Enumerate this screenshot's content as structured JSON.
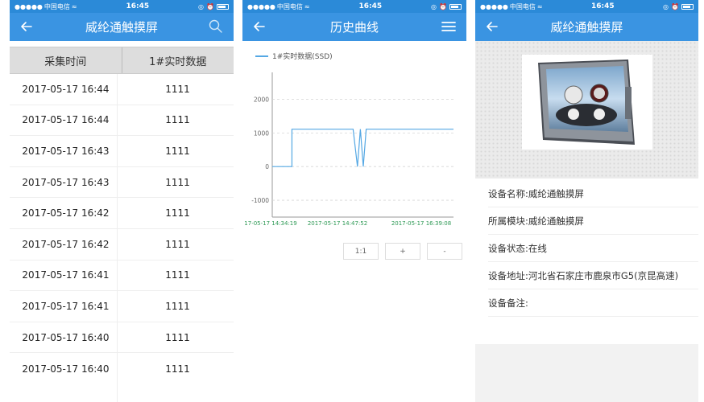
{
  "status": {
    "carrier": "中国电信",
    "time": "16:45"
  },
  "screen1": {
    "title": "威纶通触摸屏",
    "columns": [
      "采集时间",
      "1#实时数据"
    ],
    "rows": [
      [
        "2017-05-17 16:44",
        "1111"
      ],
      [
        "2017-05-17 16:44",
        "1111"
      ],
      [
        "2017-05-17 16:43",
        "1111"
      ],
      [
        "2017-05-17 16:43",
        "1111"
      ],
      [
        "2017-05-17 16:42",
        "1111"
      ],
      [
        "2017-05-17 16:42",
        "1111"
      ],
      [
        "2017-05-17 16:41",
        "1111"
      ],
      [
        "2017-05-17 16:41",
        "1111"
      ],
      [
        "2017-05-17 16:40",
        "1111"
      ],
      [
        "2017-05-17 16:40",
        "1111"
      ]
    ]
  },
  "screen2": {
    "title": "历史曲线",
    "zoom": {
      "reset": "1:1",
      "plus": "+",
      "minus": "-"
    }
  },
  "chart_data": {
    "type": "line",
    "series": [
      {
        "name": "1#实时数据(SSD)",
        "color": "#55a8e4",
        "x": [
          "14:34:19",
          "14:47:52",
          "14:47:52",
          "15:30:00",
          "15:33:00",
          "15:35:00",
          "15:37:00",
          "15:39:00",
          "16:39:08"
        ],
        "values": [
          0,
          0,
          1111,
          1111,
          0,
          1111,
          0,
          1111,
          1111
        ]
      }
    ],
    "xlabels": [
      "17-05-17 14:34:19",
      "2017-05-17 14:47:52",
      "2017-05-17 16:39:08"
    ],
    "yticks": [
      2000,
      1000,
      0,
      -1000
    ],
    "ylim": [
      -1500,
      2800
    ],
    "grid": true,
    "legend": "top-left"
  },
  "screen3": {
    "title": "威纶通触摸屏",
    "fields": [
      {
        "label": "设备名称:",
        "value": "威纶通触摸屏"
      },
      {
        "label": "所属模块:",
        "value": "威纶通触摸屏"
      },
      {
        "label": "设备状态:",
        "value": "在线"
      },
      {
        "label": "设备地址:",
        "value": "河北省石家庄市鹿泉市G5(京昆高速)"
      },
      {
        "label": "设备备注:",
        "value": ""
      }
    ]
  }
}
